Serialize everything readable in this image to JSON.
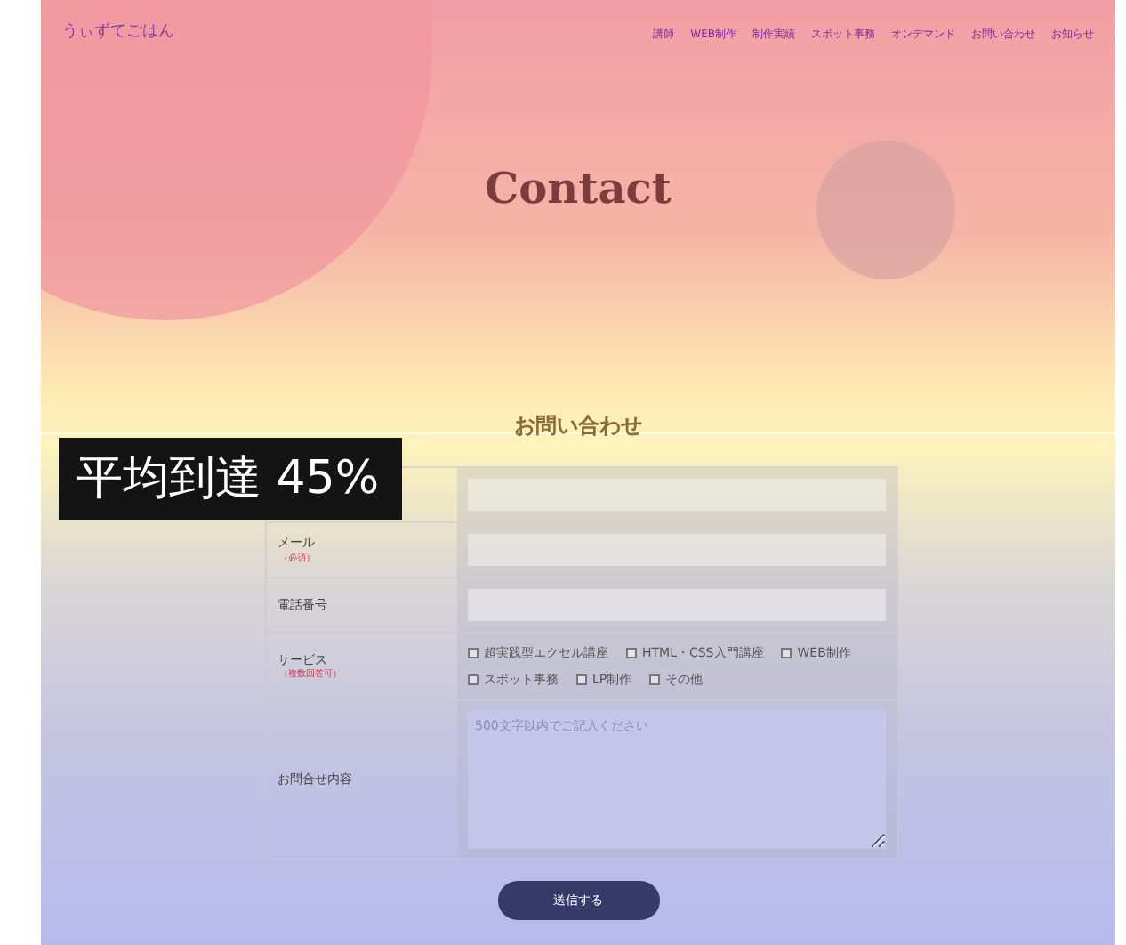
{
  "header": {
    "logo": "うぃずてごはん",
    "nav": [
      {
        "label": "講師"
      },
      {
        "label": "WEB制作"
      },
      {
        "label": "制作実績"
      },
      {
        "label": "スポット事務"
      },
      {
        "label": "オンデマンド"
      },
      {
        "label": "お問い合わせ"
      },
      {
        "label": "お知らせ"
      }
    ]
  },
  "hero": {
    "title": "Contact"
  },
  "overlay": {
    "label": "平均到達 45%"
  },
  "form": {
    "heading": "お問い合わせ",
    "rows": [
      {
        "kind": "text"
      },
      {
        "kind": "text",
        "label": "メール",
        "note": "（必須）"
      },
      {
        "kind": "text",
        "label": "電話番号"
      },
      {
        "kind": "checks",
        "label": "サービス",
        "note": "（複数回答可）",
        "options": [
          {
            "label": "超実践型エクセル講座",
            "checked": false
          },
          {
            "label": "HTML・CSS入門講座",
            "checked": false
          },
          {
            "label": "WEB制作",
            "checked": false
          },
          {
            "label": "スポット事務",
            "checked": false
          },
          {
            "label": "LP制作",
            "checked": false
          },
          {
            "label": "その他",
            "checked": false
          }
        ]
      },
      {
        "kind": "textarea",
        "label": "お問合せ内容",
        "placeholder": "500文字以内でご記入ください"
      }
    ],
    "submit": "送信する"
  }
}
